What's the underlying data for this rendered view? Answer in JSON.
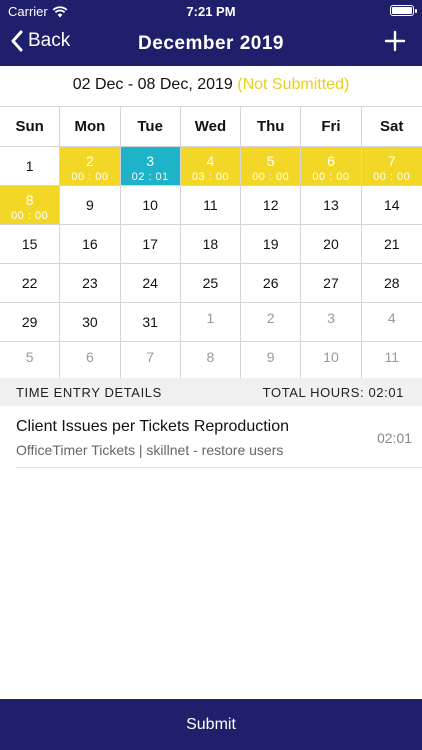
{
  "status_bar": {
    "carrier": "Carrier",
    "time": "7:21 PM"
  },
  "nav": {
    "back_label": "Back",
    "title": "December 2019"
  },
  "week": {
    "range": "02 Dec - 08 Dec, 2019",
    "status": "(Not Submitted)"
  },
  "calendar": {
    "day_names": [
      "Sun",
      "Mon",
      "Tue",
      "Wed",
      "Thu",
      "Fri",
      "Sat"
    ],
    "weeks": [
      [
        {
          "day": "1",
          "hours": "",
          "state": "plain"
        },
        {
          "day": "2",
          "hours": "00 : 00",
          "state": "yellow"
        },
        {
          "day": "3",
          "hours": "02 : 01",
          "state": "blue"
        },
        {
          "day": "4",
          "hours": "03 : 00",
          "state": "yellow"
        },
        {
          "day": "5",
          "hours": "00 : 00",
          "state": "yellow"
        },
        {
          "day": "6",
          "hours": "00 : 00",
          "state": "yellow"
        },
        {
          "day": "7",
          "hours": "00 : 00",
          "state": "yellow"
        }
      ],
      [
        {
          "day": "8",
          "hours": "00 : 00",
          "state": "yellow"
        },
        {
          "day": "9",
          "hours": "",
          "state": "plain"
        },
        {
          "day": "10",
          "hours": "",
          "state": "plain"
        },
        {
          "day": "11",
          "hours": "",
          "state": "plain"
        },
        {
          "day": "12",
          "hours": "",
          "state": "plain"
        },
        {
          "day": "13",
          "hours": "",
          "state": "plain"
        },
        {
          "day": "14",
          "hours": "",
          "state": "plain"
        }
      ],
      [
        {
          "day": "15",
          "hours": "",
          "state": "plain"
        },
        {
          "day": "16",
          "hours": "",
          "state": "plain"
        },
        {
          "day": "17",
          "hours": "",
          "state": "plain"
        },
        {
          "day": "18",
          "hours": "",
          "state": "plain"
        },
        {
          "day": "19",
          "hours": "",
          "state": "plain"
        },
        {
          "day": "20",
          "hours": "",
          "state": "plain"
        },
        {
          "day": "21",
          "hours": "",
          "state": "plain"
        }
      ],
      [
        {
          "day": "22",
          "hours": "",
          "state": "plain"
        },
        {
          "day": "23",
          "hours": "",
          "state": "plain"
        },
        {
          "day": "24",
          "hours": "",
          "state": "plain"
        },
        {
          "day": "25",
          "hours": "",
          "state": "plain"
        },
        {
          "day": "26",
          "hours": "",
          "state": "plain"
        },
        {
          "day": "27",
          "hours": "",
          "state": "plain"
        },
        {
          "day": "28",
          "hours": "",
          "state": "plain"
        }
      ],
      [
        {
          "day": "29",
          "hours": "",
          "state": "plain"
        },
        {
          "day": "30",
          "hours": "",
          "state": "plain"
        },
        {
          "day": "31",
          "hours": "",
          "state": "plain"
        },
        {
          "day": "1",
          "hours": "",
          "state": "muted"
        },
        {
          "day": "2",
          "hours": "",
          "state": "muted"
        },
        {
          "day": "3",
          "hours": "",
          "state": "muted"
        },
        {
          "day": "4",
          "hours": "",
          "state": "muted"
        }
      ],
      [
        {
          "day": "5",
          "hours": "",
          "state": "muted"
        },
        {
          "day": "6",
          "hours": "",
          "state": "muted"
        },
        {
          "day": "7",
          "hours": "",
          "state": "muted"
        },
        {
          "day": "8",
          "hours": "",
          "state": "muted"
        },
        {
          "day": "9",
          "hours": "",
          "state": "muted"
        },
        {
          "day": "10",
          "hours": "",
          "state": "muted"
        },
        {
          "day": "11",
          "hours": "",
          "state": "muted"
        }
      ]
    ]
  },
  "details": {
    "header_label": "TIME ENTRY DETAILS",
    "total_hours": "TOTAL HOURS: 02:01",
    "entries": [
      {
        "title": "Client Issues per Tickets Reproduction",
        "subtitle": "OfficeTimer Tickets | skillnet - restore users",
        "time": "02:01"
      }
    ]
  },
  "footer": {
    "submit_label": "Submit"
  },
  "colors": {
    "navy": "#1f1f6b",
    "yellow": "#f2d727",
    "cyan": "#1fb3c9",
    "status_yellow": "#e8cf1c"
  }
}
